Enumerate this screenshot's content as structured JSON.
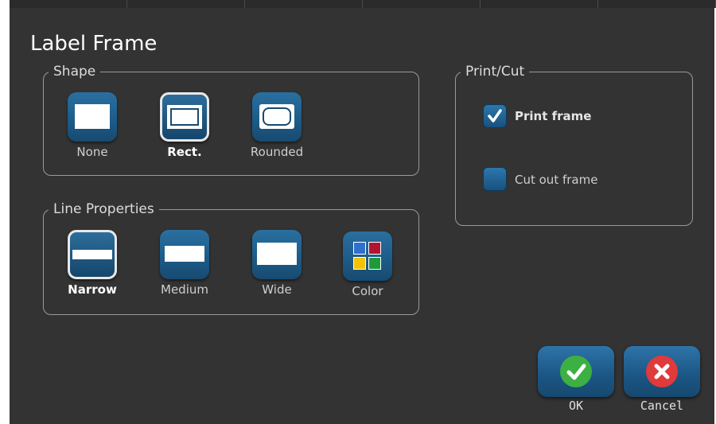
{
  "dialog": {
    "title": "Label Frame"
  },
  "shape": {
    "legend": "Shape",
    "options": [
      {
        "label": "None",
        "icon": "none-frame-icon",
        "selected": false
      },
      {
        "label": "Rect.",
        "icon": "rect-frame-icon",
        "selected": true
      },
      {
        "label": "Rounded",
        "icon": "rounded-frame-icon",
        "selected": false
      }
    ]
  },
  "line_properties": {
    "legend": "Line Properties",
    "options": [
      {
        "label": "Narrow",
        "icon": "narrow-line-icon",
        "selected": true
      },
      {
        "label": "Medium",
        "icon": "medium-line-icon",
        "selected": false
      },
      {
        "label": "Wide",
        "icon": "wide-line-icon",
        "selected": false
      },
      {
        "label": "Color",
        "icon": "color-grid-icon",
        "selected": false
      }
    ],
    "color_swatches": [
      "#2f6fcf",
      "#b2152f",
      "#f2c20a",
      "#1e9a3a"
    ]
  },
  "print_cut": {
    "legend": "Print/Cut",
    "print_frame": {
      "label": "Print frame",
      "checked": true
    },
    "cut_out_frame": {
      "label": "Cut out frame",
      "checked": false
    }
  },
  "actions": {
    "ok": {
      "label": "OK",
      "color": "#3cb043"
    },
    "cancel": {
      "label": "Cancel",
      "color": "#e03a3a"
    }
  },
  "colors": {
    "background": "#333333",
    "button": "#1e5e8c",
    "accent_border": "#9a9a9a"
  }
}
